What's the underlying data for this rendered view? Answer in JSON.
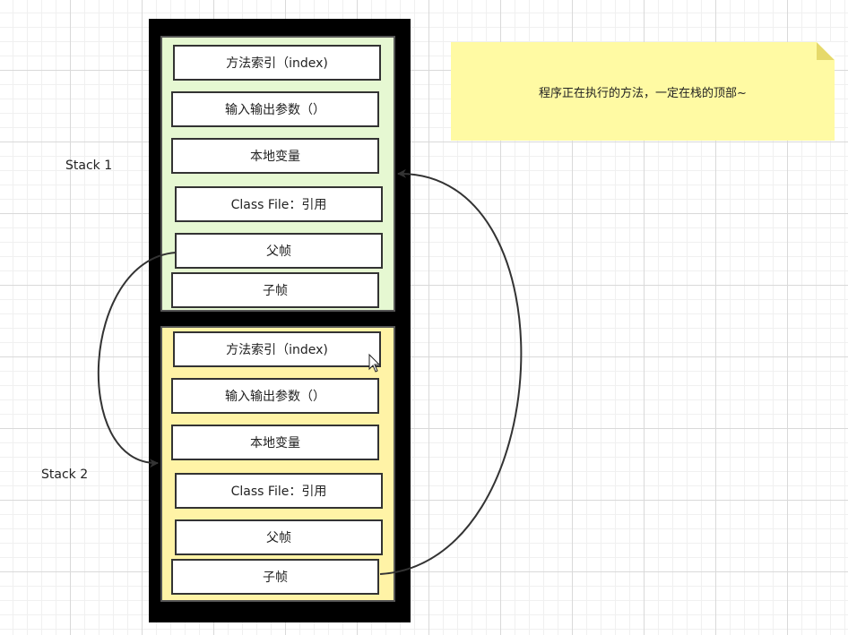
{
  "labels": {
    "stack1": "Stack 1",
    "stack2": "Stack 2"
  },
  "note": {
    "text": "程序正在执行的方法，一定在栈的顶部~"
  },
  "stack1": {
    "cells": [
      "方法索引（index)",
      "输入输出参数（）",
      "本地变量",
      "Class File：引用",
      "父帧",
      "子帧"
    ]
  },
  "stack2": {
    "cells": [
      "方法索引（index)",
      "输入输出参数（）",
      "本地变量",
      "Class File：引用",
      "父帧",
      "子帧"
    ]
  },
  "colors": {
    "stack1_fill": "#e6f8d2",
    "stack2_fill": "#fff3a6",
    "note_fill": "#fffaa3",
    "outer_border": "#000000"
  }
}
